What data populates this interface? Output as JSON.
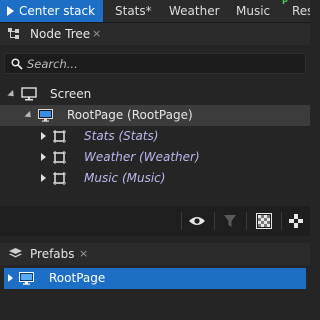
{
  "tabs": [
    {
      "label": "Center stack",
      "active": true
    },
    {
      "label": "Stats*",
      "active": false
    },
    {
      "label": "Weather",
      "active": false
    },
    {
      "label": "Music",
      "active": false
    },
    {
      "label": "Res",
      "active": false
    }
  ],
  "tab_indicator": "P",
  "node_tree": {
    "title": "Node Tree",
    "close_glyph": "×",
    "search_placeholder": "Search...",
    "items": [
      {
        "label": "Screen",
        "icon": "monitor-icon"
      },
      {
        "label": "RootPage (RootPage)",
        "icon": "page-icon"
      },
      {
        "label": "Stats (Stats)",
        "icon": "component-icon"
      },
      {
        "label": "Weather (Weather)",
        "icon": "component-icon"
      },
      {
        "label": "Music (Music)",
        "icon": "component-icon"
      }
    ]
  },
  "toolbar": {
    "icons": [
      "eye-icon",
      "filter-icon",
      "checkerboard-icon",
      "checkerboard-small-icon"
    ]
  },
  "prefabs": {
    "title": "Prefabs",
    "close_glyph": "×",
    "items": [
      {
        "label": "RootPage",
        "icon": "page-icon",
        "selected": true
      }
    ]
  },
  "colors": {
    "accent": "#1c6fc4",
    "background": "#252525",
    "italic_text": "#b9b9ef",
    "indicator_green": "#4fbf4f"
  }
}
